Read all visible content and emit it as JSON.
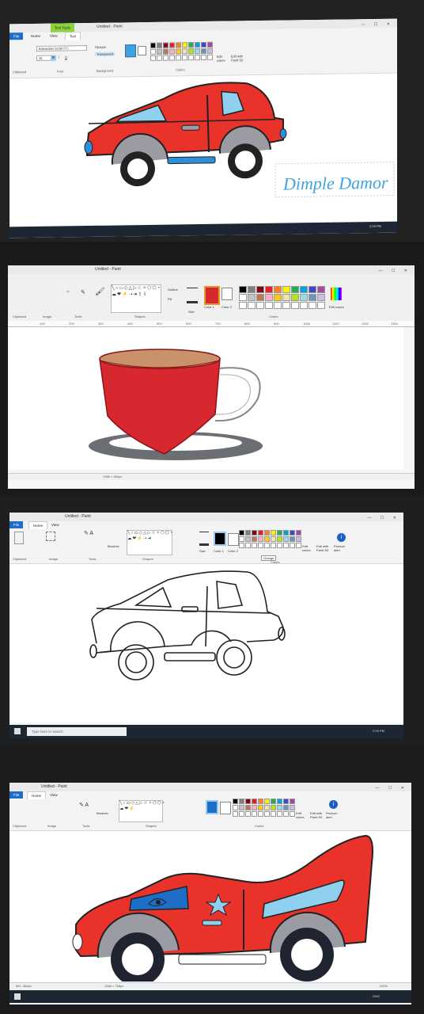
{
  "panel1": {
    "title": "Untitled - Paint",
    "text_tools_tab": "Text Tools",
    "tabs": [
      "File",
      "Home",
      "View",
      "Text"
    ],
    "font_name": "Edwardian Script ITC",
    "font_size": "36",
    "options": [
      "Opaque",
      "Transparent"
    ],
    "groups": [
      "Clipboard",
      "Font",
      "Background",
      "Colors"
    ],
    "color_label": "Color 1",
    "edit_colors": "Edit colors",
    "edit_paint3d": "Edit with Paint 3D",
    "canvas_text": "Dimple Damor",
    "clock": "2:09 PM"
  },
  "panel2": {
    "title": "Untitled - Paint",
    "groups": [
      "Clipboard",
      "Image",
      "Tools",
      "Shapes",
      "Colors"
    ],
    "outline": "Outline",
    "fill": "Fill",
    "size_label": "Size",
    "color1": "Color 1",
    "color2": "Color 2",
    "edit_colors": "Edit colors",
    "ruler": [
      "100",
      "200",
      "300",
      "400",
      "500",
      "600",
      "700",
      "800",
      "900",
      "1000",
      "1100",
      "1200",
      "1300"
    ],
    "status_size": "1366 × 662px"
  },
  "panel3": {
    "title": "Untitled - Paint",
    "tabs": [
      "File",
      "Home",
      "View"
    ],
    "groups": [
      "Clipboard",
      "Image",
      "Tools",
      "Shapes",
      "Colors"
    ],
    "brushes": "Brushes",
    "size_label": "Size",
    "color1": "Color 1",
    "color2": "Color 2",
    "edit_colors": "Edit colors",
    "edit_paint3d": "Edit with Paint 3D",
    "product_alert": "Product alert",
    "tooltip": "Orange",
    "search_placeholder": "Type here to search",
    "clock": "2:09 PM"
  },
  "panel4": {
    "title": "Untitled - Paint",
    "tabs": [
      "File",
      "Home",
      "View"
    ],
    "groups": [
      "Clipboard",
      "Image",
      "Tools",
      "Shapes",
      "Colors"
    ],
    "brushes": "Brushes",
    "edit_colors": "Edit colors",
    "edit_paint3d": "Edit with Paint 3D",
    "product_alert": "Product alert",
    "status_pos": "561, 466px",
    "status_size": "1366 × 768px",
    "zoom": "100%",
    "clock": "ENG"
  },
  "palette": [
    "#000000",
    "#7f7f7f",
    "#880015",
    "#ed1c24",
    "#ff7f27",
    "#fff200",
    "#22b14c",
    "#00a2e8",
    "#3f48cc",
    "#a349a4",
    "#ffffff",
    "#c3c3c3",
    "#b97a57",
    "#ffaec9",
    "#ffc90e",
    "#efe4b0",
    "#b5e61d",
    "#99d9ea",
    "#7092be",
    "#c8bfe7",
    "#ffffff",
    "#ffffff",
    "#ffffff",
    "#ffffff",
    "#ffffff",
    "#ffffff",
    "#ffffff",
    "#ffffff",
    "#ffffff",
    "#ffffff"
  ],
  "colors": {
    "car_red": "#e8322a",
    "window_blue": "#8fd0ee",
    "wheel": "#222222",
    "hub": "#9b9ba3",
    "cup_red": "#d8282f",
    "tea": "#c9926a",
    "saucer": "#6b6e73",
    "signature": "#3fa3e0"
  }
}
